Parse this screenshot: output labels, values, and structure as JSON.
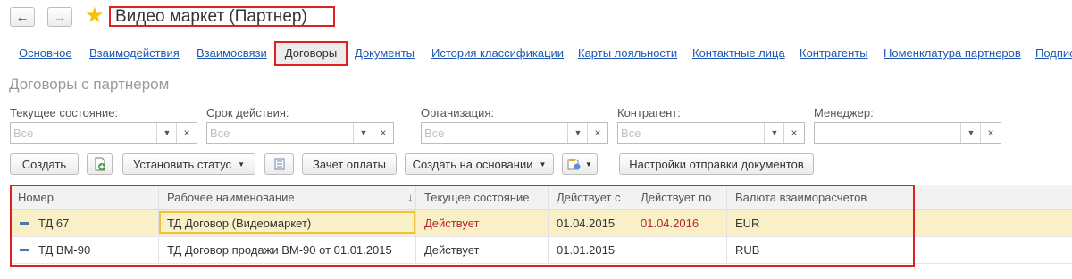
{
  "header": {
    "back_icon": "arrow-left-icon",
    "forward_icon": "arrow-right-icon",
    "favorite_icon": "star-icon",
    "title": "Видео маркет (Партнер)"
  },
  "tabs": [
    {
      "label": "Основное"
    },
    {
      "label": "Взаимодействия"
    },
    {
      "label": "Взаимосвязи"
    },
    {
      "label": "Договоры",
      "active": true
    },
    {
      "label": "Документы"
    },
    {
      "label": "История классификации"
    },
    {
      "label": "Карты лояльности"
    },
    {
      "label": "Контактные лица"
    },
    {
      "label": "Контрагенты"
    },
    {
      "label": "Номенклатура партнеров"
    },
    {
      "label": "Подпис"
    }
  ],
  "section_title": "Договоры с партнером",
  "filters": [
    {
      "label": "Текущее состояние:",
      "placeholder": "Все"
    },
    {
      "label": "Срок действия:",
      "placeholder": "Все"
    },
    {
      "label": "Организация:",
      "placeholder": "Все"
    },
    {
      "label": "Контрагент:",
      "placeholder": "Все"
    },
    {
      "label": "Менеджер:",
      "placeholder": ""
    }
  ],
  "toolbar": {
    "create": "Создать",
    "set_status": "Установить статус",
    "payment_offset": "Зачет оплаты",
    "create_based_on": "Создать на основании",
    "send_settings": "Настройки отправки документов"
  },
  "table": {
    "columns": [
      "Номер",
      "Рабочее наименование",
      "Текущее состояние",
      "Действует с",
      "Действует по",
      "Валюта взаиморасчетов"
    ],
    "sort_indicator": "↓",
    "rows": [
      {
        "number": "ТД 67",
        "name": "ТД Договор (Видеомаркет)",
        "state": "Действует",
        "from": "01.04.2015",
        "to": "01.04.2016",
        "currency": "EUR"
      },
      {
        "number": "ТД ВМ-90",
        "name": "ТД Договор продажи ВМ-90 от 01.01.2015",
        "state": "Действует",
        "from": "01.01.2015",
        "to": "",
        "currency": "RUB"
      }
    ]
  },
  "colors": {
    "link": "#1f57b4",
    "highlight": "#e02020",
    "selected_row": "#faf0c8",
    "status_red": "#b02a2a",
    "star": "#f5c400"
  }
}
